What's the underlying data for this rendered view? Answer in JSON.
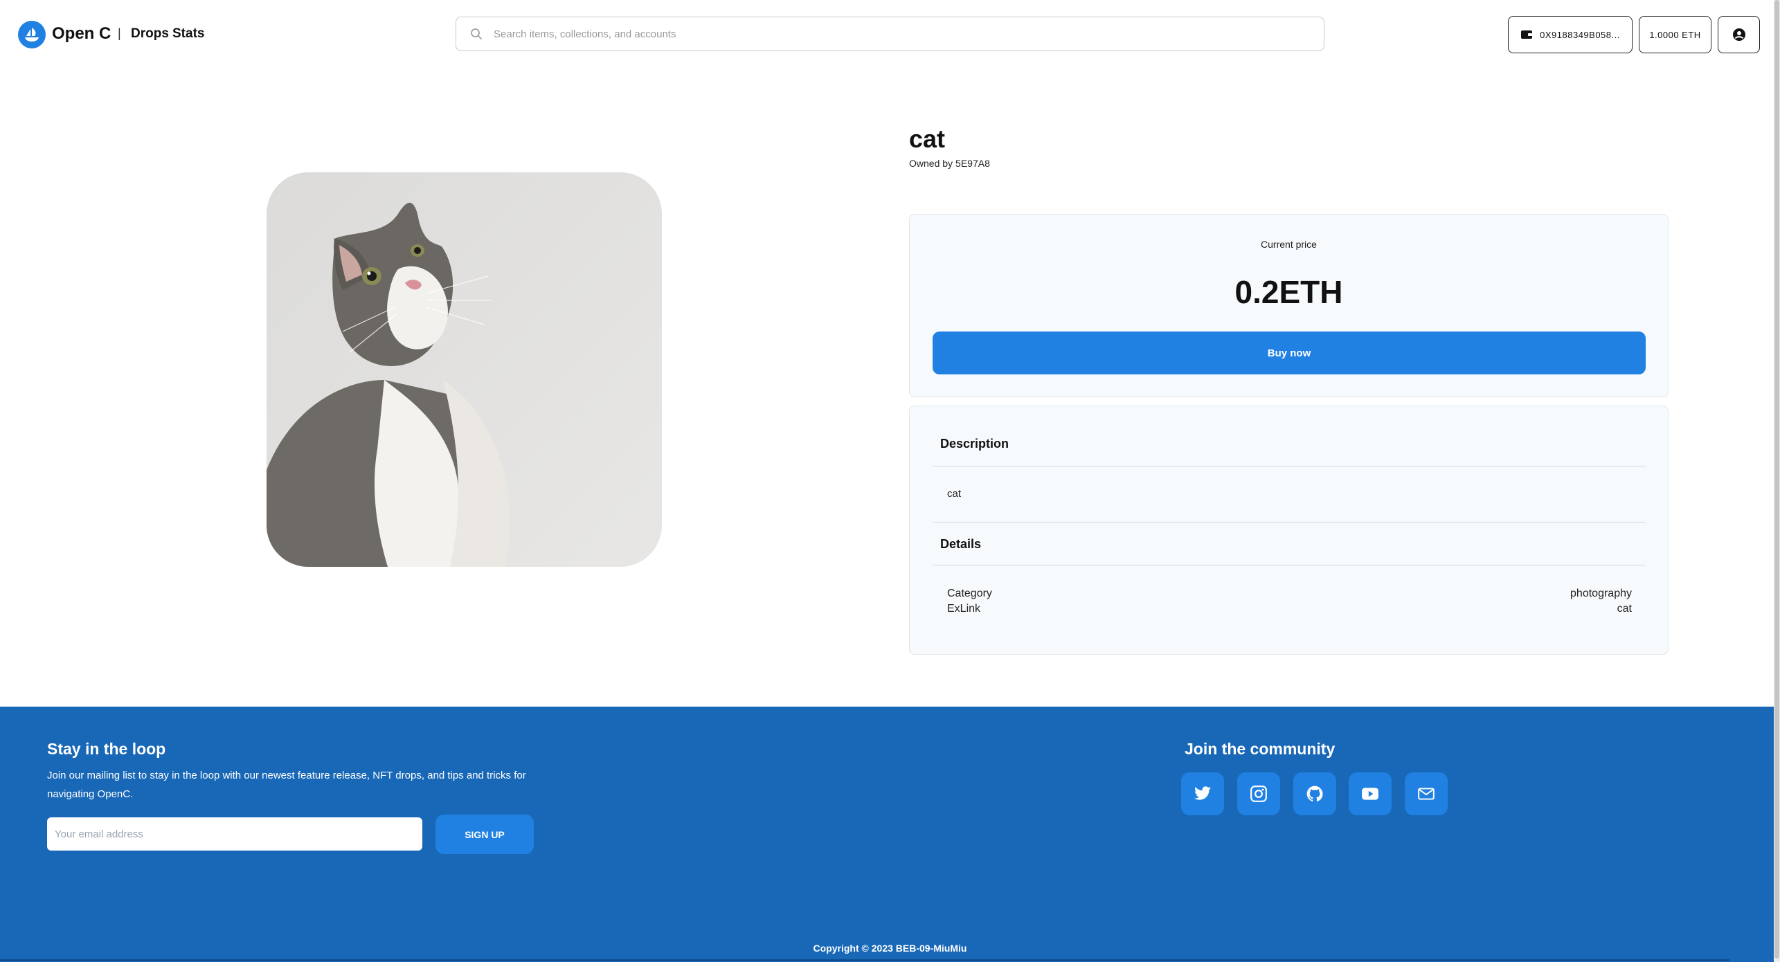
{
  "header": {
    "brand": "Open C",
    "separator": "|",
    "nav": [
      "Drops",
      "Stats"
    ],
    "search_placeholder": "Search items, collections, and accounts",
    "wallet_address": "0X9188349B058...",
    "balance": "1.0000 ETH"
  },
  "item": {
    "name": "cat",
    "owned_prefix": "Owned by",
    "owner": "5E97A8",
    "price_label": "Current price",
    "price": "0.2ETH",
    "buy_label": "Buy now"
  },
  "description": {
    "heading": "Description",
    "text": "cat"
  },
  "details": {
    "heading": "Details",
    "rows": [
      {
        "label": "Category",
        "value": "photography"
      },
      {
        "label": "ExLink",
        "value": "cat"
      }
    ]
  },
  "footer": {
    "newsletter_title": "Stay in the loop",
    "newsletter_text": "Join our mailing list to stay in the loop with our newest feature release, NFT drops, and tips and tricks for navigating OpenC.",
    "email_placeholder": "Your email address",
    "signup_label": "SIGN UP",
    "community_title": "Join the community",
    "social_icons": [
      "twitter-icon",
      "instagram-icon",
      "github-icon",
      "youtube-icon",
      "mail-icon"
    ],
    "copyright": "Copyright © 2023 BEB-09-MiuMiu"
  },
  "colors": {
    "accent": "#2081e2",
    "footer_bg": "#1868b7"
  }
}
